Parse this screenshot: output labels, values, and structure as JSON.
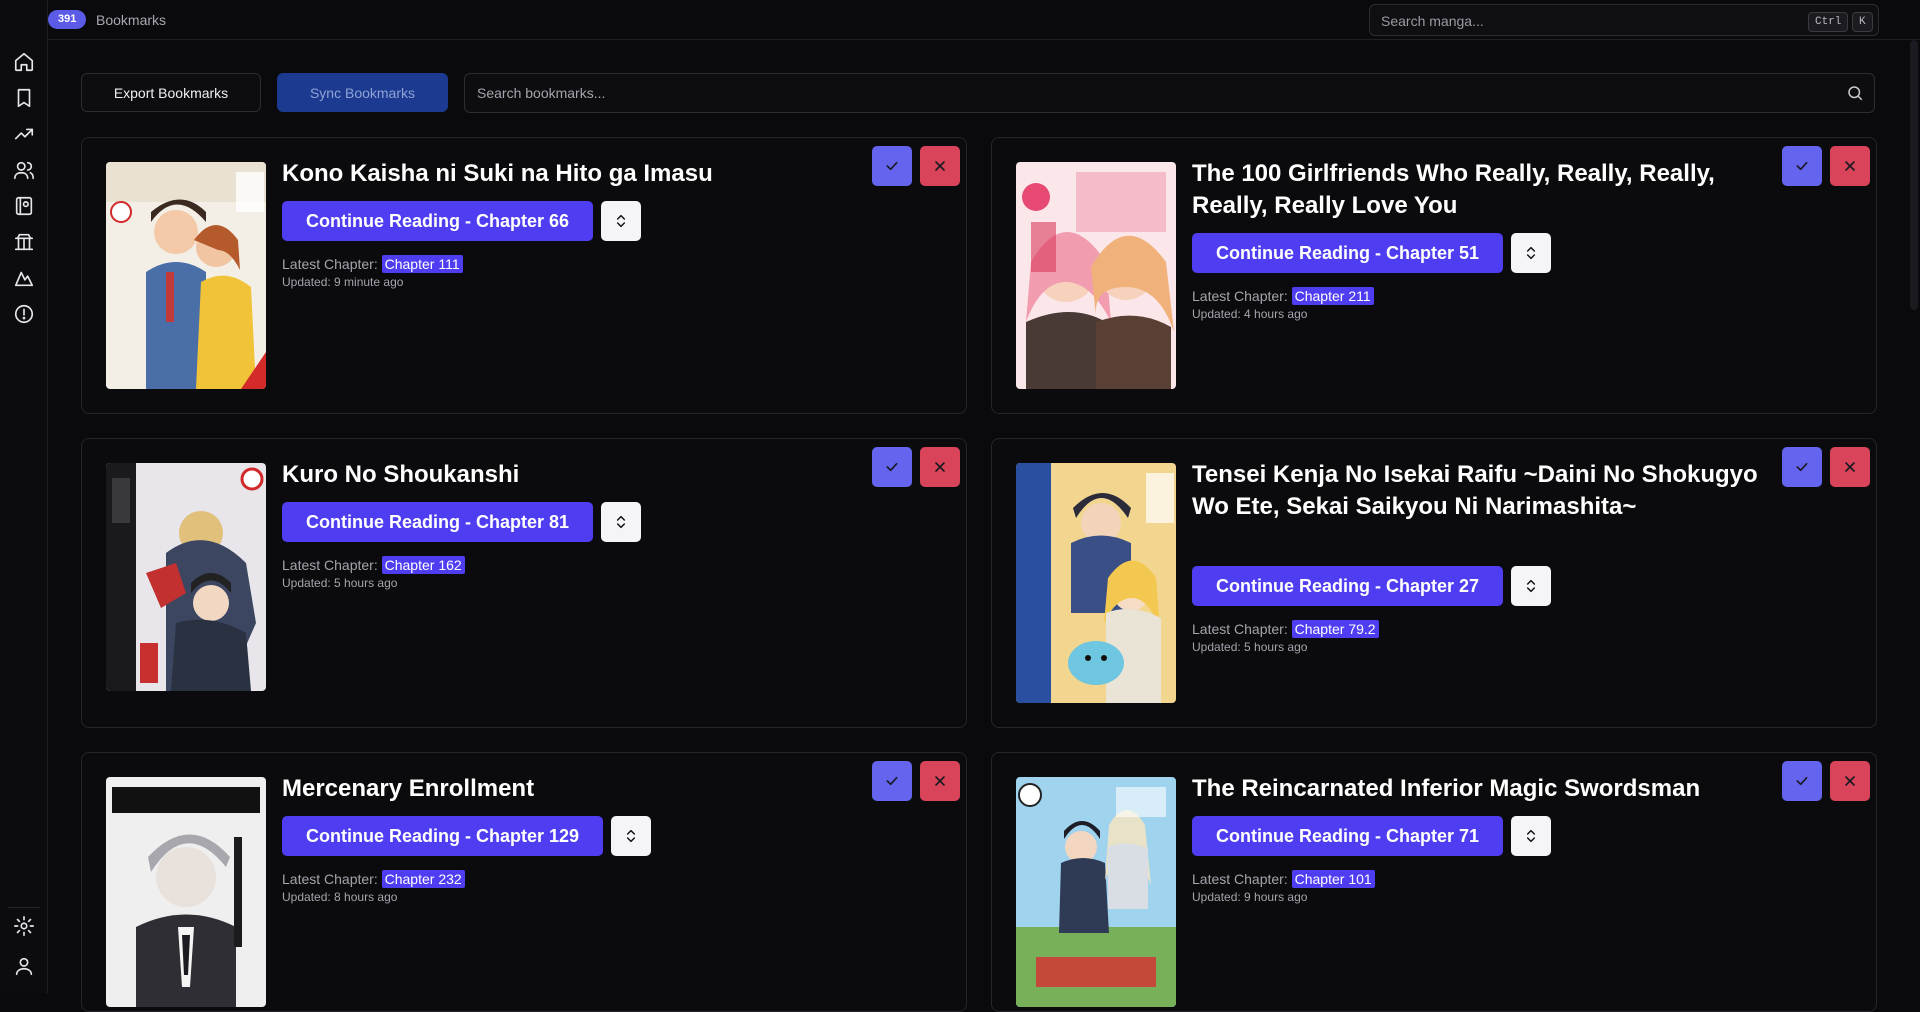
{
  "topbar": {
    "bookmark_count": "391",
    "breadcrumb": "Bookmarks",
    "search_placeholder": "Search manga...",
    "shortcut_key1": "Ctrl",
    "shortcut_key2": "K"
  },
  "sidebar": {
    "items": [
      {
        "icon": "home-icon"
      },
      {
        "icon": "bookmark-icon"
      },
      {
        "icon": "trending-icon"
      },
      {
        "icon": "users-icon"
      },
      {
        "icon": "book-icon"
      },
      {
        "icon": "landmark-icon"
      },
      {
        "icon": "mountain-icon"
      },
      {
        "icon": "alert-circle-icon"
      }
    ],
    "bottom": [
      {
        "icon": "gear-icon"
      },
      {
        "icon": "user-icon"
      }
    ]
  },
  "toolbar": {
    "export_label": "Export Bookmarks",
    "sync_label": "Sync Bookmarks",
    "search_placeholder": "Search bookmarks..."
  },
  "labels": {
    "latest_prefix": "Latest Chapter:"
  },
  "bookmarks": [
    {
      "title": "Kono Kaisha ni Suki na Hito ga Imasu",
      "continue": "Continue Reading - Chapter 66",
      "latest": "Chapter 111",
      "updated": "Updated: 9 minute ago"
    },
    {
      "title": "The 100 Girlfriends Who Really, Really, Really, Really, Really Love You",
      "continue": "Continue Reading - Chapter 51",
      "latest": "Chapter 211",
      "updated": "Updated: 4 hours ago"
    },
    {
      "title": "Kuro No Shoukanshi",
      "continue": "Continue Reading - Chapter 81",
      "latest": "Chapter 162",
      "updated": "Updated: 5 hours ago"
    },
    {
      "title": "Tensei Kenja No Isekai Raifu ~Daini No Shokugyo Wo Ete, Sekai Saikyou Ni Narimashita~",
      "continue": "Continue Reading - Chapter 27",
      "latest": "Chapter 79.2",
      "updated": "Updated: 5 hours ago"
    },
    {
      "title": "Mercenary Enrollment",
      "continue": "Continue Reading - Chapter 129",
      "latest": "Chapter 232",
      "updated": "Updated: 8 hours ago"
    },
    {
      "title": "The Reincarnated Inferior Magic Swordsman",
      "continue": "Continue Reading - Chapter 71",
      "latest": "Chapter 101",
      "updated": "Updated: 9 hours ago"
    }
  ],
  "colors": {
    "accent": "#4f3df2",
    "confirm": "#6464ee",
    "remove": "#d9445a",
    "sync": "#1c3a8f"
  }
}
